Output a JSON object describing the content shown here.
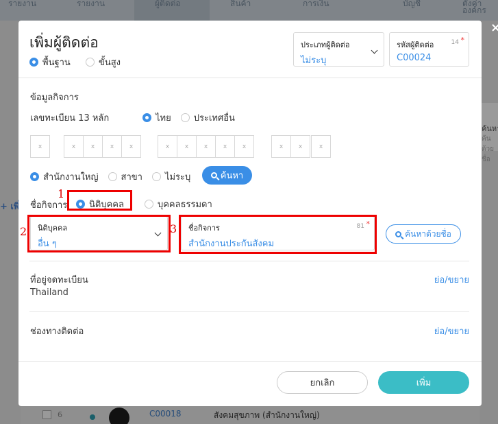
{
  "background": {
    "tabs": [
      "รายงาน",
      "รายงาน",
      "ผู้ติดต่อ",
      "สินค้า",
      "การเงิน",
      "บัญชี",
      "ตั้งค่าองค์กร"
    ],
    "left_plus": "+ เพิ่",
    "right_panel_line1": "ค้นหา",
    "right_panel_line2": "ค้นด้วยชื่อ",
    "row": {
      "num": "6",
      "code": "C00018",
      "name": "สังคมสุขภาพ (สำนักงานใหญ่)"
    },
    "close_symbol": "×"
  },
  "modal": {
    "title": "เพิ่มผู้ติดต่อ",
    "modes": [
      {
        "label": "พื้นฐาน",
        "selected": true
      },
      {
        "label": "ขั้นสูง",
        "selected": false
      }
    ],
    "contact_type": {
      "label": "ประเภทผู้ติดต่อ",
      "value": "ไม่ระบุ"
    },
    "contact_code": {
      "label": "รหัสผู้ติดต่อ",
      "value": "C00024",
      "count": "14",
      "required": "*"
    }
  },
  "business": {
    "section_title": "ข้อมูลกิจการ",
    "tax_id_label": "เลขทะเบียน 13 หลัก",
    "country_options": [
      {
        "label": "ไทย",
        "selected": true
      },
      {
        "label": "ประเทศอื่น",
        "selected": false
      }
    ],
    "digit_placeholder": "x",
    "branch_options": [
      {
        "label": "สำนักงานใหญ่",
        "selected": true
      },
      {
        "label": "สาขา",
        "selected": false
      },
      {
        "label": "ไม่ระบุ",
        "selected": false
      }
    ],
    "search_button": "ค้นหา",
    "business_type_label": "ชื่อกิจการ",
    "entity_options": [
      {
        "label": "นิติบุคคล",
        "selected": true
      },
      {
        "label": "บุคคลธรรมดา",
        "selected": false
      }
    ],
    "entity_kind": {
      "label": "นิติบุคคล",
      "value": "อื่น ๆ"
    },
    "business_name": {
      "label": "ชื่อกิจการ",
      "value": "สำนักงานประกันสังคม",
      "count": "81",
      "required": "*"
    },
    "search_by_name_button": "ค้นหาด้วยชื่อ"
  },
  "annotations": [
    "1",
    "2",
    "3"
  ],
  "address": {
    "title": "ที่อยู่จดทะเบียน",
    "value": "Thailand",
    "toggle": "ย่อ/ขยาย"
  },
  "channels": {
    "title": "ช่องทางติดต่อ",
    "toggle": "ย่อ/ขยาย"
  },
  "footer": {
    "cancel": "ยกเลิก",
    "submit": "เพิ่ม"
  },
  "colors": {
    "accent": "#3a8ee6",
    "submit": "#3bbdc6",
    "annotation_red": "#e00000"
  }
}
